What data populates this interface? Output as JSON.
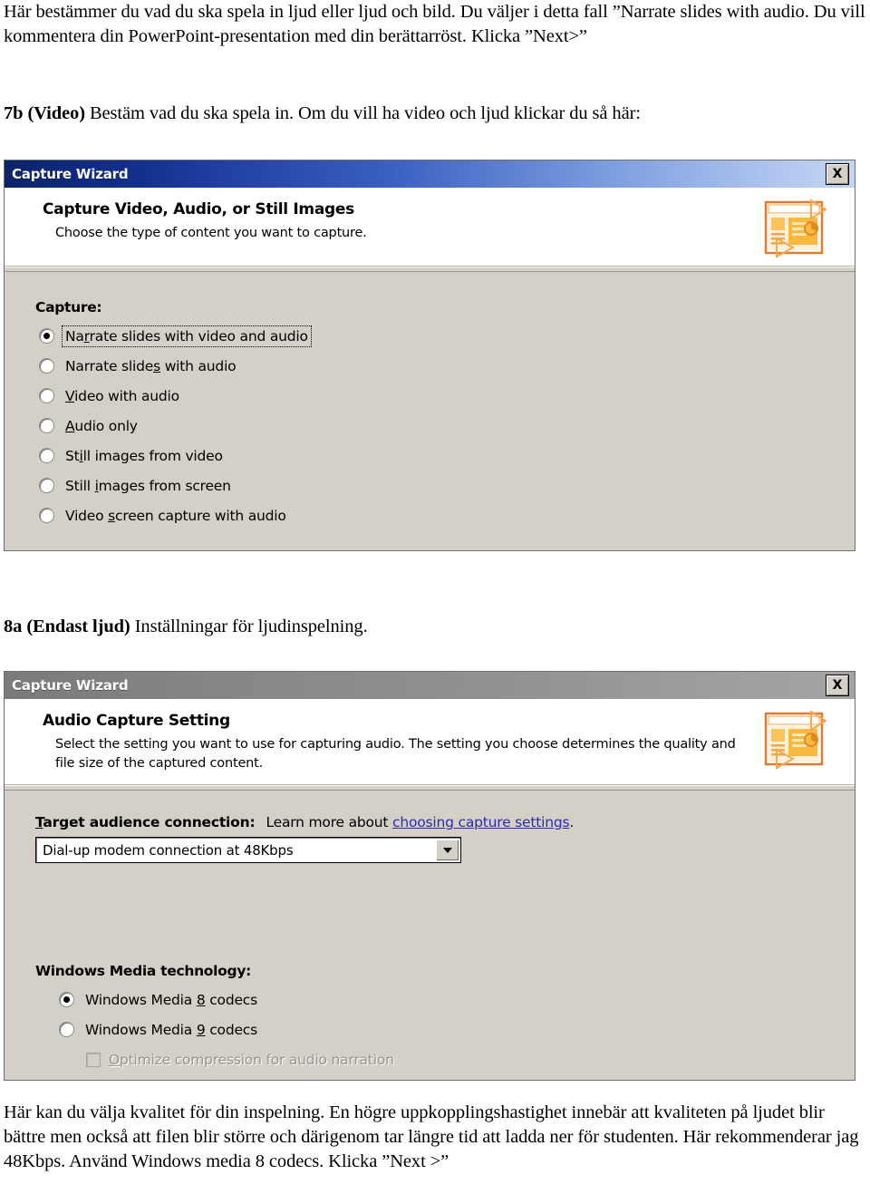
{
  "document": {
    "intro_paragraph": "Här bestämmer du vad du ska spela in ljud eller ljud och bild. Du väljer i detta fall ”Narrate slides with audio. Du vill kommentera din PowerPoint-presentation med din berättarröst. Klicka ”Next>”",
    "step_7b_bold": "7b (Video)",
    "step_7b_rest": " Bestäm vad du ska spela in. Om du vill ha video och ljud klickar du så här:",
    "step_8a_bold": "8a (Endast ljud)",
    "step_8a_rest": " Inställningar för ljudinspelning.",
    "closing_paragraph": "Här kan du välja kvalitet för din inspelning. En högre uppkopplingshastighet innebär att kvaliteten på ljudet blir bättre men också att filen blir större och därigenom tar längre tid att ladda ner för studenten. Här rekommenderar jag 48Kbps. Använd Windows media 8 codecs. Klicka ”Next >”"
  },
  "dialog1": {
    "titlebar": {
      "title": "Capture Wizard",
      "close_label": "X",
      "state": "active"
    },
    "header": {
      "title": "Capture Video, Audio, or Still Images",
      "subtitle": "Choose the type of content you want to capture."
    },
    "group_label": "Capture:",
    "options": [
      {
        "label": "Narrate slides with video and audio",
        "checked": true,
        "focused": true
      },
      {
        "label": "Narrate slides with audio",
        "checked": false,
        "focused": false
      },
      {
        "label": "Video with audio",
        "checked": false,
        "focused": false
      },
      {
        "label": "Audio only",
        "checked": false,
        "focused": false
      },
      {
        "label": "Still images from video",
        "checked": false,
        "focused": false
      },
      {
        "label": "Still images from screen",
        "checked": false,
        "focused": false
      },
      {
        "label": "Video screen capture with audio",
        "checked": false,
        "focused": false
      }
    ]
  },
  "dialog2": {
    "titlebar": {
      "title": "Capture Wizard",
      "close_label": "X",
      "state": "inactive"
    },
    "header": {
      "title": "Audio Capture Setting",
      "subtitle": "Select the setting you want to use for capturing audio. The setting you choose determines the quality and file size of the captured content."
    },
    "target_audience": {
      "label": "Target audience connection:",
      "note_prefix": "Learn more about ",
      "link_text": "choosing capture settings",
      "note_suffix": ".",
      "selected_value": "Dial-up modem connection at 48Kbps"
    },
    "media_technology": {
      "group_label": "Windows Media technology:",
      "options": [
        {
          "label": "Windows Media 8 codecs",
          "checked": true
        },
        {
          "label": "Windows Media 9 codecs",
          "checked": false
        }
      ],
      "checkbox": {
        "label": "Optimize compression for audio narration",
        "checked": false,
        "disabled": true
      }
    }
  },
  "colors": {
    "titlebar_active_start": "#0a246a",
    "titlebar_active_end": "#c3d5f2",
    "titlebar_inactive": "#909090",
    "dialog_face": "#d4d0c8",
    "link": "#2b2bb5",
    "icon_orange": "#f3a63c"
  }
}
